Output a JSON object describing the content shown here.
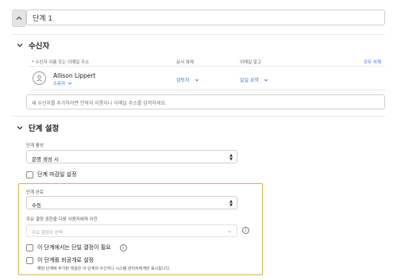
{
  "step": {
    "name": "단계 1"
  },
  "recipients": {
    "title": "수신자",
    "col_name": "* 수신자 이름 또는 이메일 주소",
    "col_action": "문서 복제",
    "col_notify": "이메일 알고",
    "delete_all": "모두 삭제",
    "person": {
      "name": "Allison Lippert",
      "role": "소유자",
      "action": "검토자",
      "notify": "일일 요약"
    },
    "add_placeholder": "새 수신자를 추가하려면 연락처 이름이나 이메일 주소를 입력하세요."
  },
  "step_settings": {
    "title": "단계 설정",
    "step_start_label": "단계 활성",
    "step_start_value": "문명 생성 시",
    "deadline_label": "단계 마감일 설정",
    "box": {
      "completion_label": "단계 완료",
      "completion_value": "수동",
      "forward_label": "주요 결정 권한을 다음 사용자에게 이전",
      "forward_placeholder": "주요 결정자 선택",
      "single_approval_label": "이 단계에서는 단일 결정이 필요",
      "private_label": "이 단계를 비공개로 설정",
      "private_note": "해당 단계에 추가된 댓글은 이 단계의 수신자나 시스템 관리자에게만 표시됩니다."
    }
  }
}
